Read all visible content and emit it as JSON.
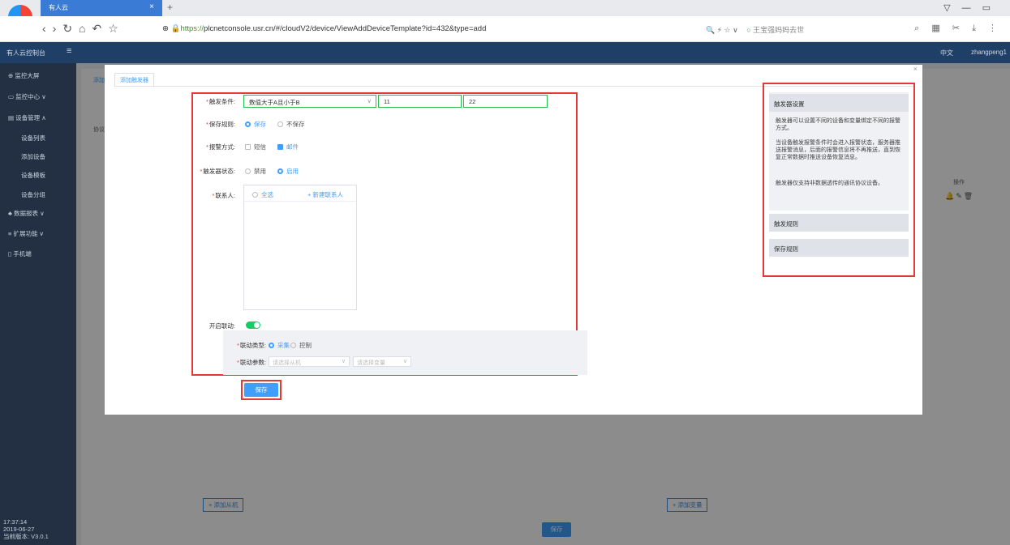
{
  "browser": {
    "tab_title": "有人云",
    "tab_close": "×",
    "new_tab": "+",
    "url_prefix": "https://",
    "url_rest": "plcnetconsole.usr.cn/#/cloudV2/device/ViewAddDeviceTemplate?id=432&type=add",
    "hot_search": "王宝强妈妈去世"
  },
  "app": {
    "brand": "有人云控制台",
    "lang": "中文",
    "user": "zhangpeng1"
  },
  "sidebar": {
    "items": [
      {
        "label": "监控大屏"
      },
      {
        "label": "监控中心"
      },
      {
        "label": "设备管理"
      },
      {
        "label": "设备列表"
      },
      {
        "label": "添加设备"
      },
      {
        "label": "设备模板"
      },
      {
        "label": "设备分组"
      },
      {
        "label": "数据报表"
      },
      {
        "label": "扩展功能"
      },
      {
        "label": "手机端"
      }
    ],
    "time": "17:37:14",
    "date": "2019-06-27",
    "version": "当前版本: V3.0.1"
  },
  "background": {
    "add_slave": "+ 添加从机",
    "add_variable": "+ 添加变量",
    "save": "保存",
    "op_header": "操作",
    "tab_partial": "添加",
    "protocol_partial": "协议"
  },
  "modal": {
    "tab": "添加触发器",
    "close": "×",
    "form": {
      "trigger_condition": {
        "label": "触发条件:",
        "value": "数值大于A且小于B",
        "a": "11",
        "b": "22"
      },
      "save_rule": {
        "label": "保存规则:",
        "options": [
          "保存",
          "不保存"
        ],
        "selected": "保存"
      },
      "alarm_method": {
        "label": "报警方式:",
        "options": [
          "短信",
          "邮件"
        ],
        "checked": [
          "邮件"
        ]
      },
      "trigger_state": {
        "label": "触发器状态:",
        "options": [
          "禁用",
          "启用"
        ],
        "selected": "启用"
      },
      "contacts": {
        "label": "联系人:",
        "select_all": "全选",
        "new_contact": "+ 新建联系人"
      },
      "linkage": {
        "label": "开启联动:",
        "enabled": true
      },
      "linkage_type": {
        "label": "联动类型:",
        "options": [
          "采集",
          "控制"
        ],
        "selected": "采集"
      },
      "linkage_params": {
        "label": "联动参数:",
        "slave_placeholder": "请选择从机",
        "variable_placeholder": "请选择变量"
      }
    },
    "save": "保存",
    "help": {
      "section1_title": "触发器设置",
      "paragraphs": [
        "触发器可以设置不同的设备和变量绑定不同的报警方式。",
        "当设备触发报警条件时会进入报警状态，服务器推送报警消息，后面的报警信息将不再推送，直到恢复正常数据时推送设备恢复消息。",
        "触发器仅支持非数据透传的通讯协议设备。"
      ],
      "section2_title": "触发规则",
      "section3_title": "保存规则"
    }
  },
  "colors": {
    "accent": "#409eff",
    "highlight": "#e53935",
    "header": "#1f3f66",
    "sidebar": "#233044"
  }
}
